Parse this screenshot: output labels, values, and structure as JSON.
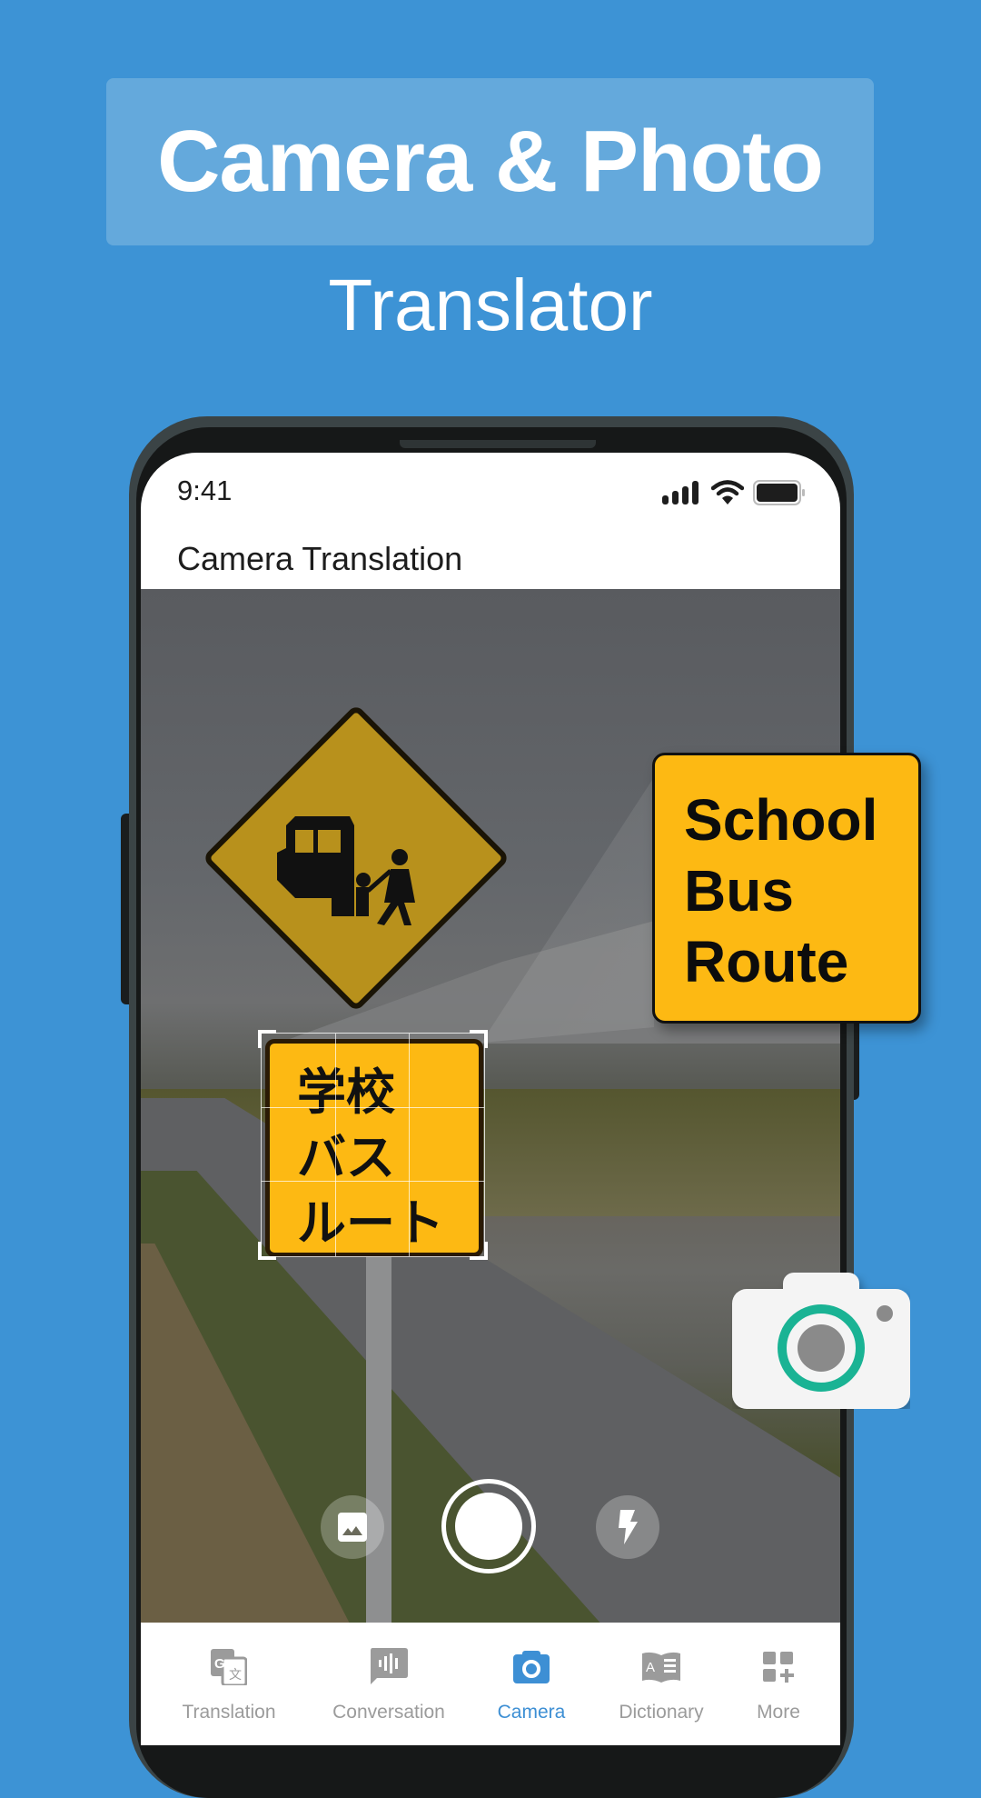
{
  "hero": {
    "title": "Camera & Photo",
    "subtitle": "Translator"
  },
  "colors": {
    "background": "#3d93d5",
    "accent": "#3d8fd4",
    "sign_yellow": "#fdb913",
    "lens_ring": "#1ab394",
    "inactive_tab": "#9b9b9b"
  },
  "status_bar": {
    "time": "9:41",
    "icons": [
      "signal-icon",
      "wifi-icon",
      "battery-icon"
    ]
  },
  "app": {
    "title": "Camera Translation"
  },
  "scan": {
    "source_text": "学校\nバス\nルート",
    "translated_text": "School\nBus\nRoute"
  },
  "camera_controls": {
    "gallery_icon": "image-icon",
    "shutter_icon": "shutter-button",
    "flash_icon": "flash-icon"
  },
  "tabs": [
    {
      "label": "Translation",
      "icon": "translate-icon",
      "active": false
    },
    {
      "label": "Conversation",
      "icon": "voice-chat-icon",
      "active": false
    },
    {
      "label": "Camera",
      "icon": "camera-icon",
      "active": true
    },
    {
      "label": "Dictionary",
      "icon": "dictionary-icon",
      "active": false
    },
    {
      "label": "More",
      "icon": "more-grid-icon",
      "active": false
    }
  ]
}
